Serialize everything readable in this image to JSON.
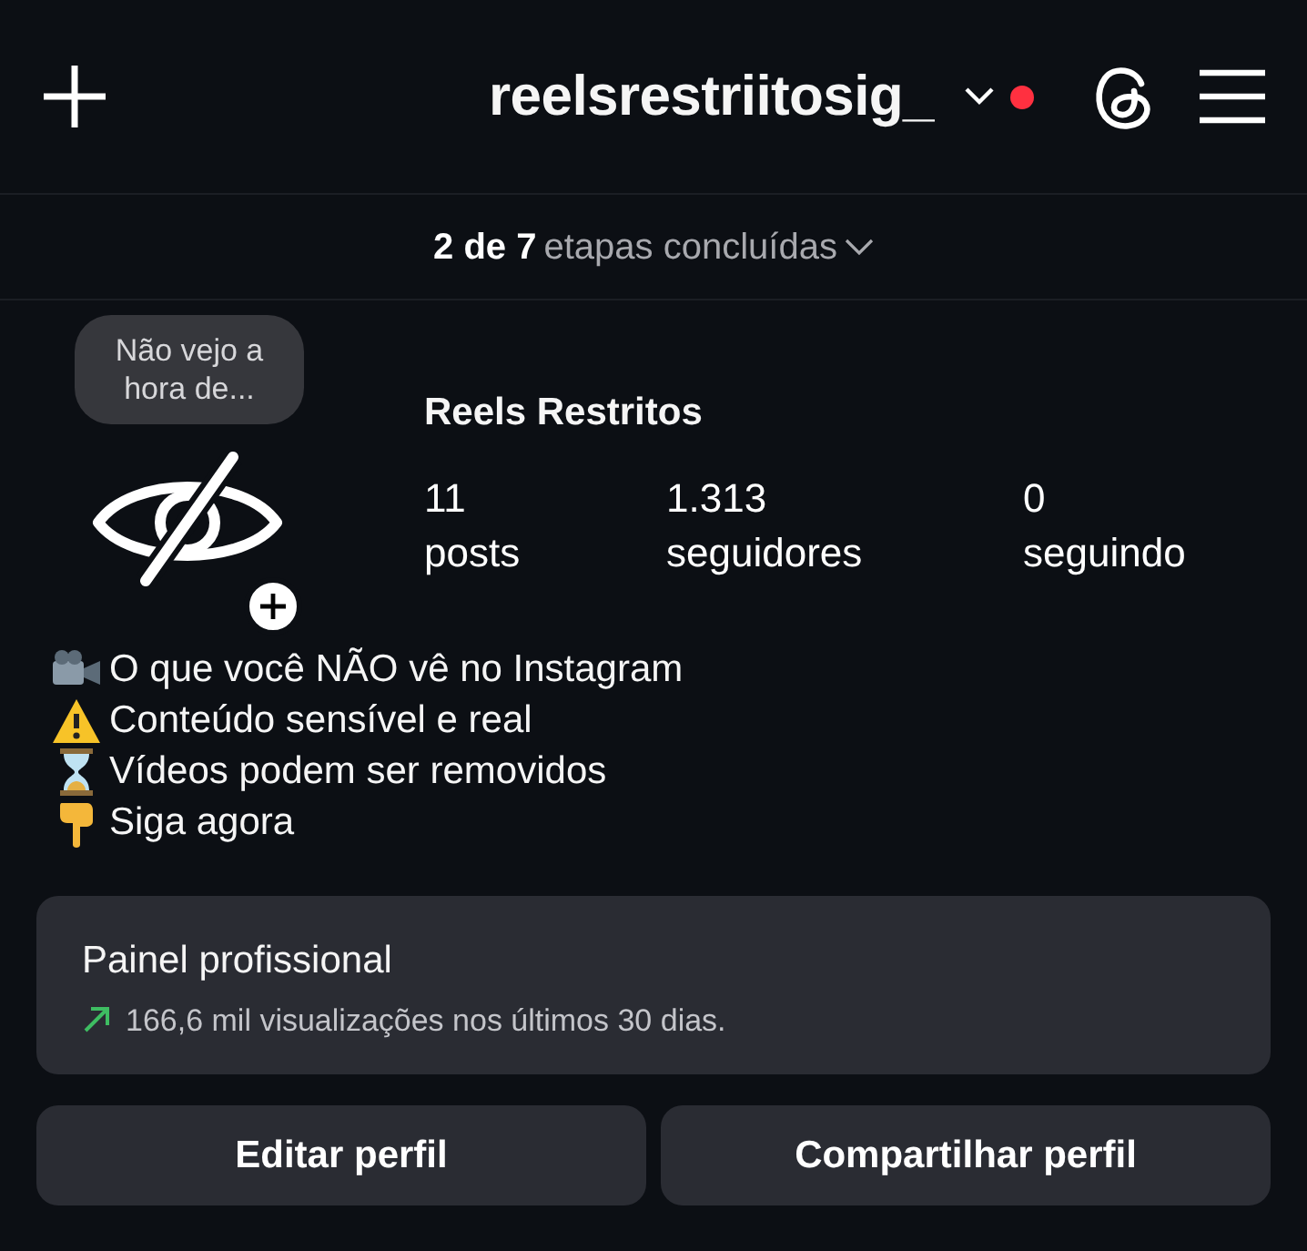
{
  "header": {
    "username": "reelsrestriitosig_",
    "notification": true
  },
  "progress": {
    "count": "2 de 7",
    "label": "etapas concluídas"
  },
  "profile": {
    "note": "Não vejo a hora de...",
    "name": "Reels Restritos",
    "stats": [
      {
        "value": "11",
        "label": "posts"
      },
      {
        "value": "1.313",
        "label": "seguidores"
      },
      {
        "value": "0",
        "label": "seguindo"
      }
    ]
  },
  "bio": [
    {
      "kind": "camera",
      "text": "O que você NÃO vê no Instagram"
    },
    {
      "kind": "warning",
      "text": "Conteúdo sensível e real"
    },
    {
      "kind": "hourglass",
      "text": "Vídeos podem ser removidos"
    },
    {
      "kind": "pointer",
      "text": "Siga agora"
    }
  ],
  "dashboard": {
    "title": "Painel profissional",
    "summary": "166,6 mil visualizações nos últimos 30 dias."
  },
  "buttons": [
    "Editar perfil",
    "Compartilhar perfil"
  ]
}
